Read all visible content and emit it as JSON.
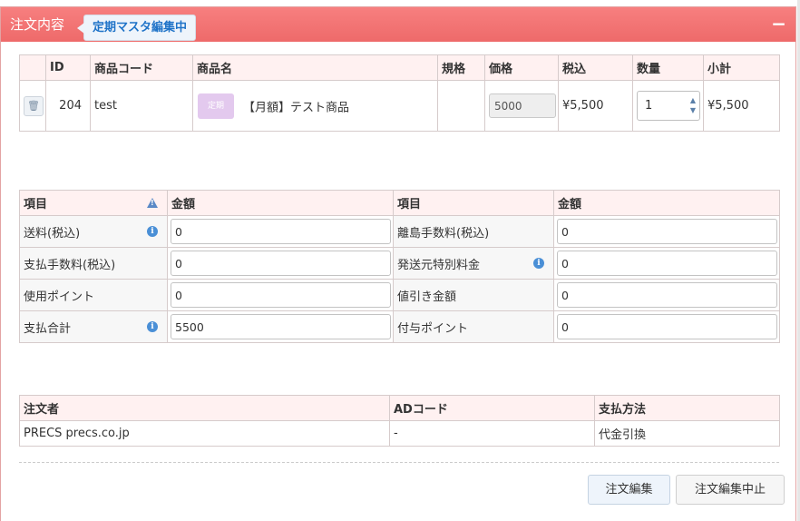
{
  "panel": {
    "title": "注文内容",
    "mode_badge": "定期マスタ編集中",
    "collapse_label": "−"
  },
  "products": {
    "headers": [
      "",
      "ID",
      "商品コード",
      "商品名",
      "規格",
      "価格",
      "税込",
      "数量",
      "小計"
    ],
    "rows": [
      {
        "id": "204",
        "code": "test",
        "tag": "定期",
        "name": "【月額】テスト商品",
        "spec": "",
        "price": "5000",
        "tax_incl": "¥5,500",
        "qty": "1",
        "subtotal": "¥5,500"
      }
    ]
  },
  "amounts": {
    "headers": [
      "項目",
      "金額",
      "項目",
      "金額"
    ],
    "rows": [
      {
        "l_label": "送料(税込)",
        "l_value": "0",
        "r_label": "離島手数料(税込)",
        "r_value": "0"
      },
      {
        "l_label": "支払手数料(税込)",
        "l_value": "0",
        "r_label": "発送元特別料金",
        "r_value": "0"
      },
      {
        "l_label": "使用ポイント",
        "l_value": "0",
        "r_label": "値引き金額",
        "r_value": "0"
      },
      {
        "l_label": "支払合計",
        "l_value": "5500",
        "r_label": "付与ポイント",
        "r_value": "0"
      }
    ]
  },
  "orderer": {
    "headers": [
      "注文者",
      "ADコード",
      "支払方法"
    ],
    "row": {
      "orderer": "PRECS precs.co.jp",
      "ad_code": "-",
      "payment": "代金引換"
    }
  },
  "buttons": {
    "edit": "注文編集",
    "cancel": "注文編集中止"
  },
  "icons": {
    "trash": "trash-icon",
    "info": "info-icon",
    "warning": "warning-icon",
    "spinner": "spinner-icon"
  }
}
